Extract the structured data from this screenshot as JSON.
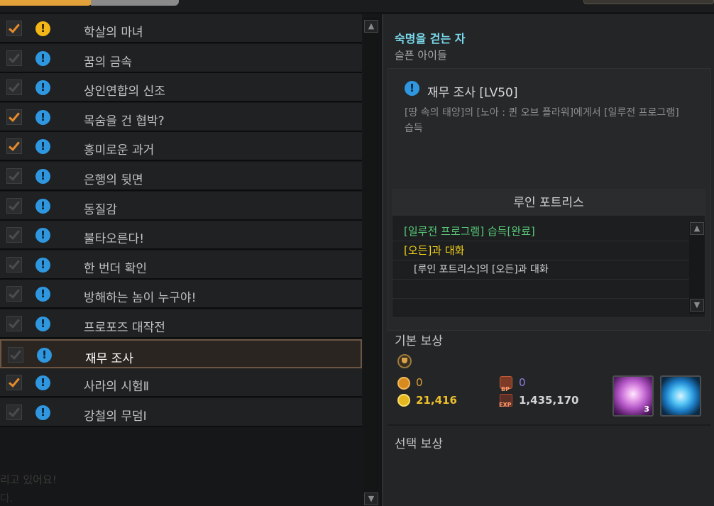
{
  "quests": [
    {
      "title": "학살의 마녀",
      "checked": true,
      "alert": "gold"
    },
    {
      "title": "꿈의 금속",
      "checked": false,
      "alert": "blue"
    },
    {
      "title": "상인연합의 신조",
      "checked": false,
      "alert": "blue"
    },
    {
      "title": "목숨을 건 협박?",
      "checked": true,
      "alert": "blue"
    },
    {
      "title": "흥미로운 과거",
      "checked": true,
      "alert": "blue"
    },
    {
      "title": "은행의 뒷면",
      "checked": false,
      "alert": "blue"
    },
    {
      "title": "동질감",
      "checked": false,
      "alert": "blue"
    },
    {
      "title": "불타오른다!",
      "checked": false,
      "alert": "blue"
    },
    {
      "title": "한 번더 확인",
      "checked": false,
      "alert": "blue"
    },
    {
      "title": "방해하는 놈이 누구야!",
      "checked": false,
      "alert": "blue"
    },
    {
      "title": "프로포즈 대작전",
      "checked": false,
      "alert": "blue"
    },
    {
      "title": "재무 조사",
      "checked": false,
      "alert": "blue",
      "selected": true
    },
    {
      "title": "사라의 시험Ⅱ",
      "checked": true,
      "alert": "blue"
    },
    {
      "title": "강철의 무덤Ⅰ",
      "checked": false,
      "alert": "blue"
    }
  ],
  "alert_glyph": "!",
  "scroll": {
    "up": "▲",
    "down": "▼"
  },
  "background_text": {
    "line1": "리고 있어요!",
    "line2": "다."
  },
  "detail": {
    "npc_title": "숙명을 걷는 자",
    "npc_subtitle": "슬픈 아이들",
    "quest_title": "재무 조사 [LV50]",
    "quest_desc": "[땅 속의 태양]의 [노아 : 퀸 오브 플라워]에게서 [일루전 프로그램] 습득",
    "objective_location": "루인 포트리스",
    "objectives": [
      {
        "text": "[일루전 프로그램] 습득[완료]",
        "state": "done"
      },
      {
        "text": "[오든]과 대화",
        "state": "current"
      },
      {
        "text": "[루인 포트리스]의 [오든]과 대화",
        "state": "sub"
      }
    ]
  },
  "rewards": {
    "basic_title": "기본 보상",
    "bronze_coin": "0",
    "gold": "21,416",
    "bp": "0",
    "exp": "1,435,170",
    "bp_label": "BP",
    "exp_label": "EXP",
    "item1_count": "3",
    "select_title": "선택 보상"
  },
  "colors": {
    "accent_orange": "#e3a13a",
    "quest_blue": "#2f97e0",
    "quest_gold": "#f2b618",
    "done_green": "#59c977",
    "current_yellow": "#f5d319",
    "npc_cyan": "#7ad9ec"
  },
  "icons": [
    "check-icon",
    "quest-alert-icon",
    "scroll-up-icon",
    "scroll-down-icon",
    "trophy-icon",
    "bronze-coin-icon",
    "gold-coin-icon",
    "bp-icon",
    "exp-icon"
  ]
}
